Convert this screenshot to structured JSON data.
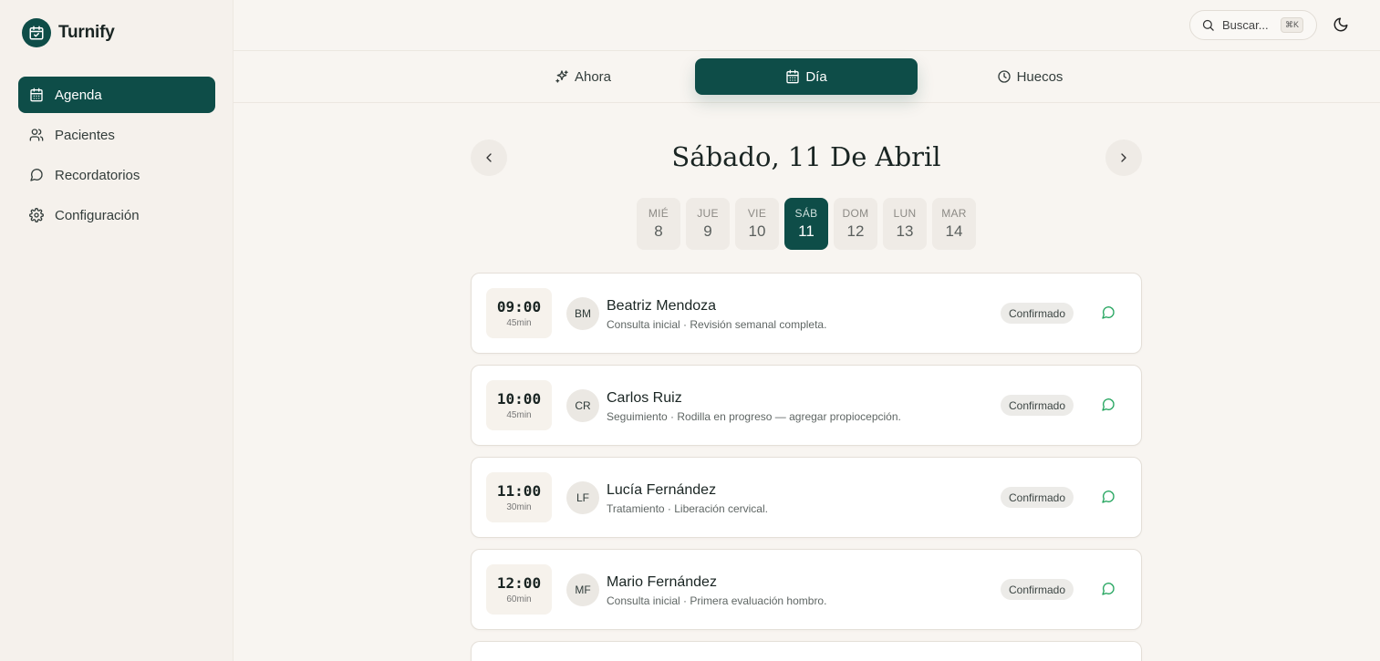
{
  "brand": {
    "name": "Turnify",
    "accent": "#0e4d48"
  },
  "sidebar": {
    "items": [
      {
        "label": "Agenda",
        "icon": "calendar-icon",
        "active": true
      },
      {
        "label": "Pacientes",
        "icon": "users-icon",
        "active": false
      },
      {
        "label": "Recordatorios",
        "icon": "message-circle-icon",
        "active": false
      },
      {
        "label": "Configuración",
        "icon": "gear-icon",
        "active": false
      }
    ]
  },
  "topbar": {
    "search_label": "Buscar...",
    "shortcut": "⌘K",
    "theme_icon": "moon-icon"
  },
  "tabs": [
    {
      "label": "Ahora",
      "icon": "sparkles-icon",
      "active": false
    },
    {
      "label": "Día",
      "icon": "calendar-icon",
      "active": true
    },
    {
      "label": "Huecos",
      "icon": "clock-icon",
      "active": false
    }
  ],
  "date": {
    "title": "Sábado, 11 De Abril"
  },
  "days": [
    {
      "weekday": "MIÉ",
      "num": "8",
      "active": false
    },
    {
      "weekday": "JUE",
      "num": "9",
      "active": false
    },
    {
      "weekday": "VIE",
      "num": "10",
      "active": false
    },
    {
      "weekday": "SÁB",
      "num": "11",
      "active": true
    },
    {
      "weekday": "DOM",
      "num": "12",
      "active": false
    },
    {
      "weekday": "LUN",
      "num": "13",
      "active": false
    },
    {
      "weekday": "MAR",
      "num": "14",
      "active": false
    }
  ],
  "appointments": [
    {
      "time": "09:00",
      "duration": "45min",
      "initials": "BM",
      "name": "Beatriz Mendoza",
      "desc": "Consulta inicial · Revisión semanal completa.",
      "status": "Confirmado"
    },
    {
      "time": "10:00",
      "duration": "45min",
      "initials": "CR",
      "name": "Carlos Ruiz",
      "desc": "Seguimiento · Rodilla en progreso — agregar propiocepción.",
      "status": "Confirmado"
    },
    {
      "time": "11:00",
      "duration": "30min",
      "initials": "LF",
      "name": "Lucía Fernández",
      "desc": "Tratamiento · Liberación cervical.",
      "status": "Confirmado"
    },
    {
      "time": "12:00",
      "duration": "60min",
      "initials": "MF",
      "name": "Mario Fernández",
      "desc": "Consulta inicial · Primera evaluación hombro.",
      "status": "Confirmado"
    }
  ],
  "colors": {
    "message_icon": "#22a45d"
  }
}
